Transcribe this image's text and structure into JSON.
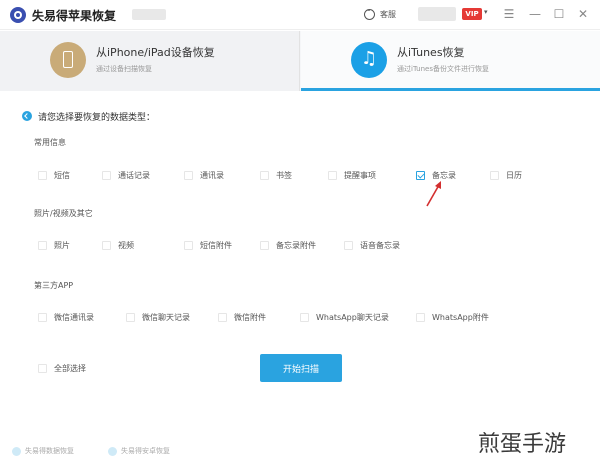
{
  "app": {
    "title": "失易得苹果恢复"
  },
  "header": {
    "help_label": "客服",
    "vip_label": "VIP",
    "caret": "▾",
    "menu_glyph": "☰",
    "minimize_glyph": "—",
    "maximize_glyph": "☐",
    "close_glyph": "✕"
  },
  "tabs": [
    {
      "title": "从iPhone/iPad设备恢复",
      "subtitle": "通过设备扫描恢复",
      "icon": "phone-icon",
      "active": false
    },
    {
      "title": "从iTunes恢复",
      "subtitle": "通过iTunes备份文件进行恢复",
      "icon": "music-note-icon",
      "active": true
    }
  ],
  "main": {
    "prompt": "请您选择要恢复的数据类型：",
    "sections": [
      {
        "title": "常用信息",
        "items": [
          {
            "label": "短信",
            "checked": false
          },
          {
            "label": "通话记录",
            "checked": false
          },
          {
            "label": "通讯录",
            "checked": false
          },
          {
            "label": "书签",
            "checked": false
          },
          {
            "label": "提醒事项",
            "checked": false
          },
          {
            "label": "备忘录",
            "checked": true
          },
          {
            "label": "日历",
            "checked": false
          }
        ]
      },
      {
        "title": "照片/视频及其它",
        "items": [
          {
            "label": "照片",
            "checked": false
          },
          {
            "label": "视频",
            "checked": false
          },
          {
            "label": "短信附件",
            "checked": false
          },
          {
            "label": "备忘录附件",
            "checked": false
          },
          {
            "label": "语音备忘录",
            "checked": false
          }
        ]
      },
      {
        "title": "第三方APP",
        "items": [
          {
            "label": "微信通讯录",
            "checked": false
          },
          {
            "label": "微信聊天记录",
            "checked": false
          },
          {
            "label": "微信附件",
            "checked": false
          },
          {
            "label": "WhatsApp聊天记录",
            "checked": false
          },
          {
            "label": "WhatsApp附件",
            "checked": false
          }
        ]
      }
    ],
    "select_all": {
      "label": "全部选择",
      "checked": false
    },
    "scan_button": "开始扫描"
  },
  "footer": {
    "links": [
      "失易得数据恢复",
      "失易得安卓恢复"
    ]
  },
  "watermark": "煎蛋手游",
  "colors": {
    "accent": "#2aa3e0",
    "vip": "#e53935",
    "tab_left_icon": "#c9ab78",
    "tab_right_icon": "#1ba0e6"
  }
}
